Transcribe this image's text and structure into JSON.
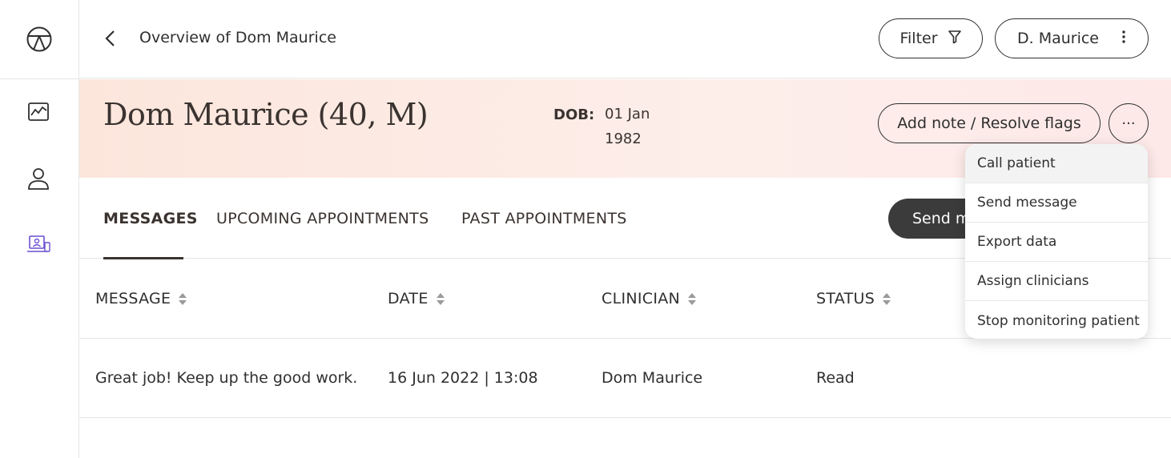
{
  "header": {
    "breadcrumb": "Overview of Dom Maurice",
    "filter_label": "Filter",
    "user_label": "D. Maurice"
  },
  "rail": {
    "items": [
      "logo-icon",
      "chart-icon",
      "person-icon",
      "monitor-person-icon"
    ],
    "active_color": "#6c4fd1"
  },
  "patient": {
    "name": "Dom Maurice (40, M)",
    "dob_label": "DOB:",
    "dob_value": "01 Jan 1982",
    "note_button": "Add note / Resolve flags",
    "more_button": "···"
  },
  "tabs": [
    {
      "label": "MESSAGES",
      "active": true
    },
    {
      "label": "UPCOMING APPOINTMENTS",
      "active": false
    },
    {
      "label": "PAST APPOINTMENTS",
      "active": false
    }
  ],
  "send_button": "Send m",
  "table": {
    "columns": [
      "MESSAGE",
      "DATE",
      "CLINICIAN",
      "STATUS"
    ],
    "rows": [
      {
        "message": "Great job! Keep up the good work.",
        "date": "16 Jun 2022 | 13:08",
        "clinician": "Dom Maurice",
        "status": "Read"
      }
    ]
  },
  "menu": {
    "items": [
      "Call patient",
      "Send message",
      "Export data",
      "Assign clinicians",
      "Stop monitoring patient"
    ]
  }
}
